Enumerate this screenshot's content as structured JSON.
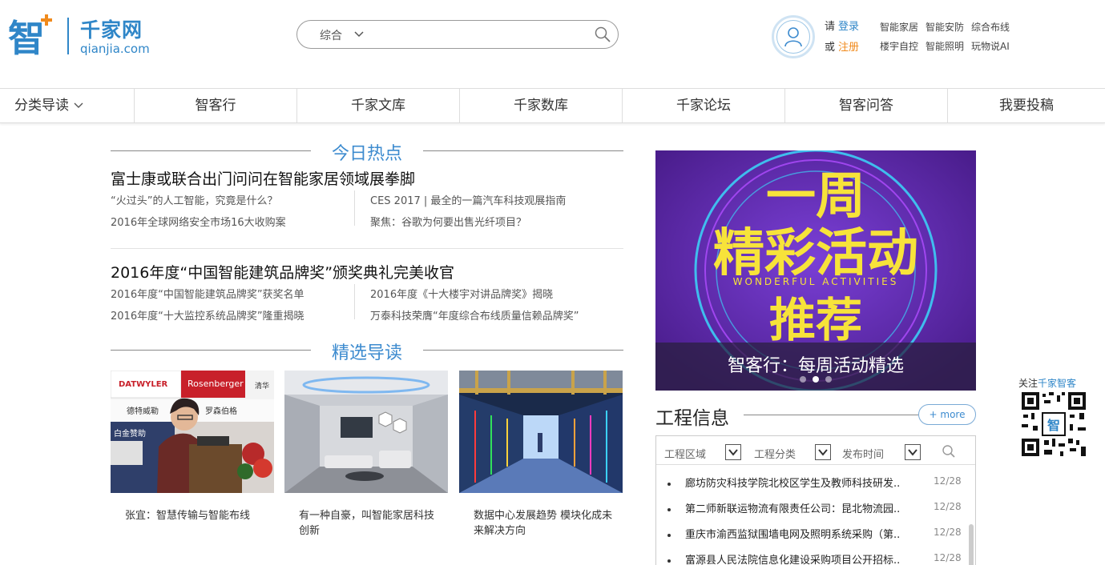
{
  "logo": {
    "cn": "千家网",
    "en": "qianjia.com",
    "mark_char": "智"
  },
  "search": {
    "type_label": "综合",
    "placeholder": ""
  },
  "account": {
    "line1_prefix": "请",
    "login": "登录",
    "line2_prefix": "或",
    "register": "注册"
  },
  "quick_links": [
    "智能家居",
    "智能安防",
    "综合布线",
    "楼宇自控",
    "智能照明",
    "玩物说AI"
  ],
  "nav": [
    "分类导读",
    "智客行",
    "千家文库",
    "千家数库",
    "千家论坛",
    "智客问答",
    "我要投稿"
  ],
  "hot": {
    "title": "今日热点",
    "groups": [
      {
        "headline": "富士康或联合出门问问在智能家居领域展拳脚",
        "links": [
          "“火过头”的人工智能，究竟是什么？",
          "CES 2017 | 最全的一篇汽车科技观展指南",
          "2016年全球网络安全市场16大收购案",
          "聚焦：谷歌为何要出售光纤项目？"
        ]
      },
      {
        "headline": "2016年度“中国智能建筑品牌奖”颁奖典礼完美收官",
        "links": [
          "2016年度“中国智能建筑品牌奖”获奖名单",
          "2016年度《十大楼宇对讲品牌奖》揭晓",
          "2016年度“十大监控系统品牌奖”隆重揭晓",
          "万泰科技荣膺“年度综合布线质量信赖品牌奖”"
        ]
      }
    ]
  },
  "featured": {
    "title": "精选导读",
    "items": [
      {
        "caption": "张宜：智慧传输与智能布线",
        "sign_texts": [
          "DATWYLER",
          "Rosenberger",
          "德特威勒",
          "罗森伯格",
          "白金赞助",
          "清华"
        ]
      },
      {
        "caption": "有一种自豪，叫智能家居科技创新"
      },
      {
        "caption": "数据中心发展趋势 模块化成未来解决方向"
      }
    ]
  },
  "banner": {
    "line1": "一周",
    "line2": "精彩活动",
    "sub": "WONDERFUL ACTIVITIES",
    "line3": "推荐",
    "caption": "智客行：每周活动精选"
  },
  "projects": {
    "title": "工程信息",
    "more": "+ more",
    "filters": [
      "工程区域",
      "工程分类",
      "发布时间"
    ],
    "rows": [
      {
        "title": "廊坊防灾科技学院北校区学生及教师科技研发..",
        "date": "12/28"
      },
      {
        "title": "第二师新联运物流有限责任公司：昆北物流园..",
        "date": "12/28"
      },
      {
        "title": "重庆市渝西监狱围墙电网及照明系统采购（第..",
        "date": "12/28"
      },
      {
        "title": "富源县人民法院信息化建设采购项目公开招标..",
        "date": "12/28"
      }
    ]
  },
  "follow": {
    "prefix": "关注",
    "name": "千家智客"
  },
  "colors": {
    "brand_blue": "#2f86c8",
    "accent_orange": "#f08a1c",
    "heading_blue": "#3d8bcf"
  }
}
